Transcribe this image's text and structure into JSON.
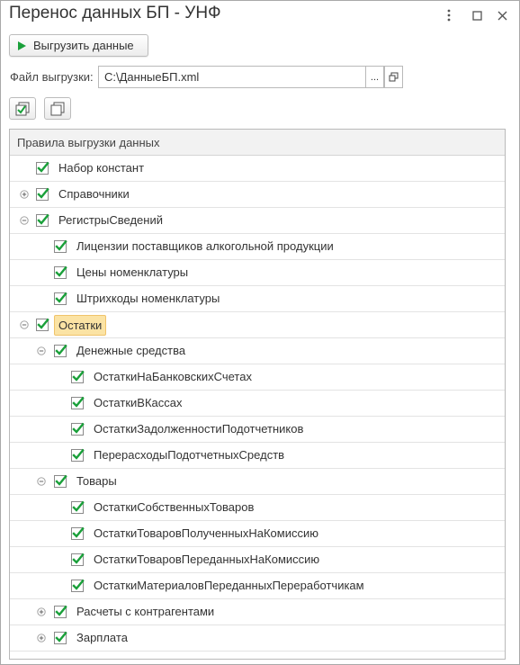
{
  "window": {
    "title": "Перенос данных БП - УНФ"
  },
  "toolbar": {
    "export_label": "Выгрузить данные"
  },
  "file": {
    "label": "Файл выгрузки:",
    "value": "C:\\ДанныеБП.xml",
    "choose_label": "..."
  },
  "table": {
    "header": "Правила выгрузки данных",
    "rows": [
      {
        "label": "Набор констант",
        "level": 0,
        "expander": "none",
        "checked": true
      },
      {
        "label": "Справочники",
        "level": 0,
        "expander": "plus",
        "checked": true
      },
      {
        "label": "РегистрыСведений",
        "level": 0,
        "expander": "minus",
        "checked": true
      },
      {
        "label": "Лицензии поставщиков алкогольной продукции",
        "level": 1,
        "expander": "none",
        "checked": true
      },
      {
        "label": "Цены номенклатуры",
        "level": 1,
        "expander": "none",
        "checked": true
      },
      {
        "label": "Штрихкоды номенклатуры",
        "level": 1,
        "expander": "none",
        "checked": true
      },
      {
        "label": "Остатки",
        "level": 0,
        "expander": "minus",
        "checked": true,
        "selected": true
      },
      {
        "label": "Денежные средства",
        "level": 1,
        "expander": "minus",
        "checked": true
      },
      {
        "label": "ОстаткиНаБанковскихСчетах",
        "level": 2,
        "expander": "none",
        "checked": true
      },
      {
        "label": "ОстаткиВКассах",
        "level": 2,
        "expander": "none",
        "checked": true
      },
      {
        "label": "ОстаткиЗадолженностиПодотчетников",
        "level": 2,
        "expander": "none",
        "checked": true
      },
      {
        "label": "ПерерасходыПодотчетныхСредств",
        "level": 2,
        "expander": "none",
        "checked": true
      },
      {
        "label": "Товары",
        "level": 1,
        "expander": "minus",
        "checked": true
      },
      {
        "label": "ОстаткиСобственныхТоваров",
        "level": 2,
        "expander": "none",
        "checked": true
      },
      {
        "label": "ОстаткиТоваровПолученныхНаКомиссию",
        "level": 2,
        "expander": "none",
        "checked": true
      },
      {
        "label": "ОстаткиТоваровПереданныхНаКомиссию",
        "level": 2,
        "expander": "none",
        "checked": true
      },
      {
        "label": "ОстаткиМатериаловПереданныхПереработчикам",
        "level": 2,
        "expander": "none",
        "checked": true
      },
      {
        "label": "Расчеты с контрагентами",
        "level": 1,
        "expander": "plus",
        "checked": true
      },
      {
        "label": "Зарплата",
        "level": 1,
        "expander": "plus",
        "checked": true
      }
    ]
  },
  "colors": {
    "check_green": "#1aa03a",
    "selection_bg": "#fbe3a4",
    "header_bg": "#f2f2f2"
  },
  "icons": {
    "export": "play-icon",
    "menu": "more-vertical-icon",
    "maximize": "maximize-icon",
    "close": "close-icon",
    "check_all": "check-all-icon",
    "uncheck_all": "uncheck-all-icon",
    "open_file": "open-window-icon"
  }
}
